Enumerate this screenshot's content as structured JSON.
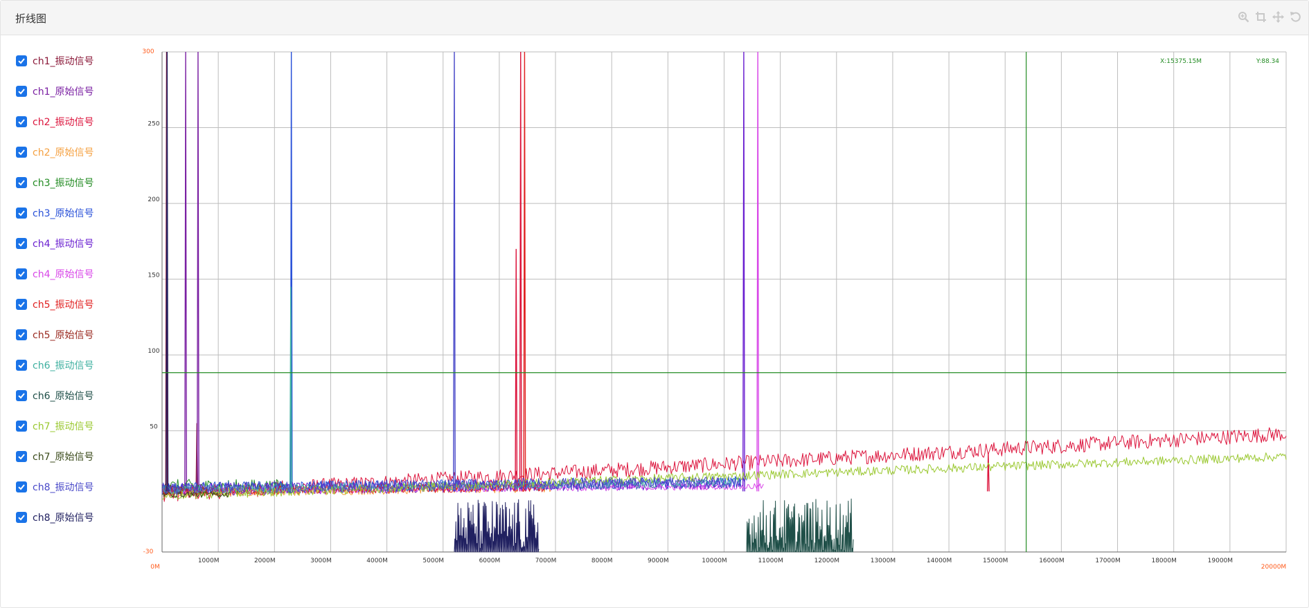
{
  "header": {
    "title": "折线图"
  },
  "toolbar": {
    "icons": [
      "zoom-icon",
      "crop-icon",
      "move-icon",
      "reset-icon"
    ],
    "color": "#c8c8c8"
  },
  "legend": {
    "items": [
      {
        "label": "ch1_振动信号",
        "color": "#8b1a3a",
        "checked": true
      },
      {
        "label": "ch1_原始信号",
        "color": "#7a1fa2",
        "checked": true
      },
      {
        "label": "ch2_振动信号",
        "color": "#dc143c",
        "checked": true
      },
      {
        "label": "ch2_原始信号",
        "color": "#f5a040",
        "checked": true
      },
      {
        "label": "ch3_振动信号",
        "color": "#228b22",
        "checked": true
      },
      {
        "label": "ch3_原始信号",
        "color": "#2850d8",
        "checked": true
      },
      {
        "label": "ch4_振动信号",
        "color": "#6a1fd0",
        "checked": true
      },
      {
        "label": "ch4_原始信号",
        "color": "#d846e8",
        "checked": true
      },
      {
        "label": "ch5_振动信号",
        "color": "#e02020",
        "checked": true
      },
      {
        "label": "ch5_原始信号",
        "color": "#9a2a20",
        "checked": true
      },
      {
        "label": "ch6_振动信号",
        "color": "#3fb0a0",
        "checked": true
      },
      {
        "label": "ch6_原始信号",
        "color": "#1f4f48",
        "checked": true
      },
      {
        "label": "ch7_振动信号",
        "color": "#9ac830",
        "checked": true
      },
      {
        "label": "ch7_原始信号",
        "color": "#3a4a1a",
        "checked": true
      },
      {
        "label": "ch8_振动信号",
        "color": "#4848c8",
        "checked": true
      },
      {
        "label": "ch8_原始信号",
        "color": "#202060",
        "checked": true
      }
    ]
  },
  "crosshair": {
    "x_label": "X:15375.15M",
    "y_label": "Y:88.34",
    "x": 15375.15,
    "y": 88.34,
    "color": "#228b22"
  },
  "chart_data": {
    "type": "line",
    "xlim": [
      0,
      20000
    ],
    "ylim": [
      -30,
      300
    ],
    "x_min_label": "0M",
    "x_max_label": "20000M",
    "xticks": [
      1000,
      2000,
      3000,
      4000,
      5000,
      6000,
      7000,
      8000,
      9000,
      10000,
      11000,
      12000,
      13000,
      14000,
      15000,
      16000,
      17000,
      18000,
      19000
    ],
    "xtick_labels": [
      "1000M",
      "2000M",
      "3000M",
      "4000M",
      "5000M",
      "6000M",
      "7000M",
      "8000M",
      "9000M",
      "10000M",
      "11000M",
      "12000M",
      "13000M",
      "14000M",
      "15000M",
      "16000M",
      "17000M",
      "18000M",
      "19000M"
    ],
    "yticks": [
      50,
      100,
      150,
      200,
      250
    ],
    "ytick_labels": [
      "50",
      "100",
      "150",
      "200",
      "250"
    ],
    "y_min_label": "-30",
    "y_max_label": "300",
    "grid": true,
    "extent_color": "#ff5a1a",
    "series": [
      {
        "name": "ch1_振动信号",
        "color": "#8b1a3a",
        "x_end": 700,
        "base": 11,
        "slope": 0,
        "noise": 4,
        "spikes": [
          [
            80,
            300
          ],
          [
            620,
            55
          ]
        ]
      },
      {
        "name": "ch1_原始信号",
        "color": "#7a1fa2",
        "x_end": 700,
        "base": 12,
        "slope": 0,
        "noise": 3,
        "spikes": [
          [
            420,
            300
          ],
          [
            640,
            300
          ]
        ]
      },
      {
        "name": "ch2_振动信号",
        "color": "#dc143c",
        "x_end": 20000,
        "base": 8,
        "slope": 2.0,
        "noise": 5,
        "spikes": [
          [
            6300,
            170
          ],
          [
            6380,
            300
          ],
          [
            14700,
            35
          ]
        ]
      },
      {
        "name": "ch2_原始信号",
        "color": "#f5a040",
        "x_end": 7000,
        "base": 9,
        "slope": 0.5,
        "noise": 3,
        "spikes": []
      },
      {
        "name": "ch3_振动信号",
        "color": "#228b22",
        "x_end": 2300,
        "base": 13,
        "slope": 0,
        "noise": 5,
        "spikes": []
      },
      {
        "name": "ch3_原始信号",
        "color": "#2850d8",
        "x_end": 10400,
        "base": 12,
        "slope": 0.4,
        "noise": 4,
        "spikes": [
          [
            2300,
            300
          ]
        ]
      },
      {
        "name": "ch4_振动信号",
        "color": "#6a1fd0",
        "x_end": 10000,
        "base": 11,
        "slope": 0.4,
        "noise": 4,
        "spikes": [
          [
            10350,
            300
          ]
        ]
      },
      {
        "name": "ch4_原始信号",
        "color": "#d846e8",
        "x_end": 10700,
        "base": 10,
        "slope": 0.3,
        "noise": 2,
        "spikes": [
          [
            10600,
            300
          ]
        ]
      },
      {
        "name": "ch5_振动信号",
        "color": "#e02020",
        "x_end": 6800,
        "base": 10,
        "slope": 0.4,
        "noise": 3,
        "spikes": [
          [
            6450,
            300
          ]
        ]
      },
      {
        "name": "ch5_原始信号",
        "color": "#9a2a20",
        "x_end": 1000,
        "base": 10,
        "slope": 0,
        "noise": 3,
        "spikes": []
      },
      {
        "name": "ch6_振动信号",
        "color": "#3fb0a0",
        "x_end": 10300,
        "base": 11,
        "slope": 0.5,
        "noise": 3,
        "spikes": [
          [
            2290,
            145
          ]
        ]
      },
      {
        "name": "ch6_原始信号",
        "color": "#1f4f48",
        "x_end": 12300,
        "base": -26,
        "slope": 0,
        "noise": 0,
        "spikes": [],
        "region": [
          10400,
          12300,
          -30,
          5
        ]
      },
      {
        "name": "ch7_振动信号",
        "color": "#9ac830",
        "x_end": 20000,
        "base": 7,
        "slope": 1.3,
        "noise": 3,
        "spikes": []
      },
      {
        "name": "ch7_原始信号",
        "color": "#3a4a1a",
        "x_end": 1200,
        "base": 8,
        "slope": 0,
        "noise": 2,
        "spikes": []
      },
      {
        "name": "ch8_振动信号",
        "color": "#4848c8",
        "x_end": 10300,
        "base": 12,
        "slope": 0.4,
        "noise": 4,
        "spikes": [
          [
            5200,
            300
          ]
        ]
      },
      {
        "name": "ch8_原始信号",
        "color": "#202060",
        "x_end": 6700,
        "base": -26,
        "slope": 0,
        "noise": 0,
        "spikes": [
          [
            90,
            300
          ]
        ],
        "region": [
          5200,
          6700,
          -30,
          5
        ]
      }
    ]
  }
}
